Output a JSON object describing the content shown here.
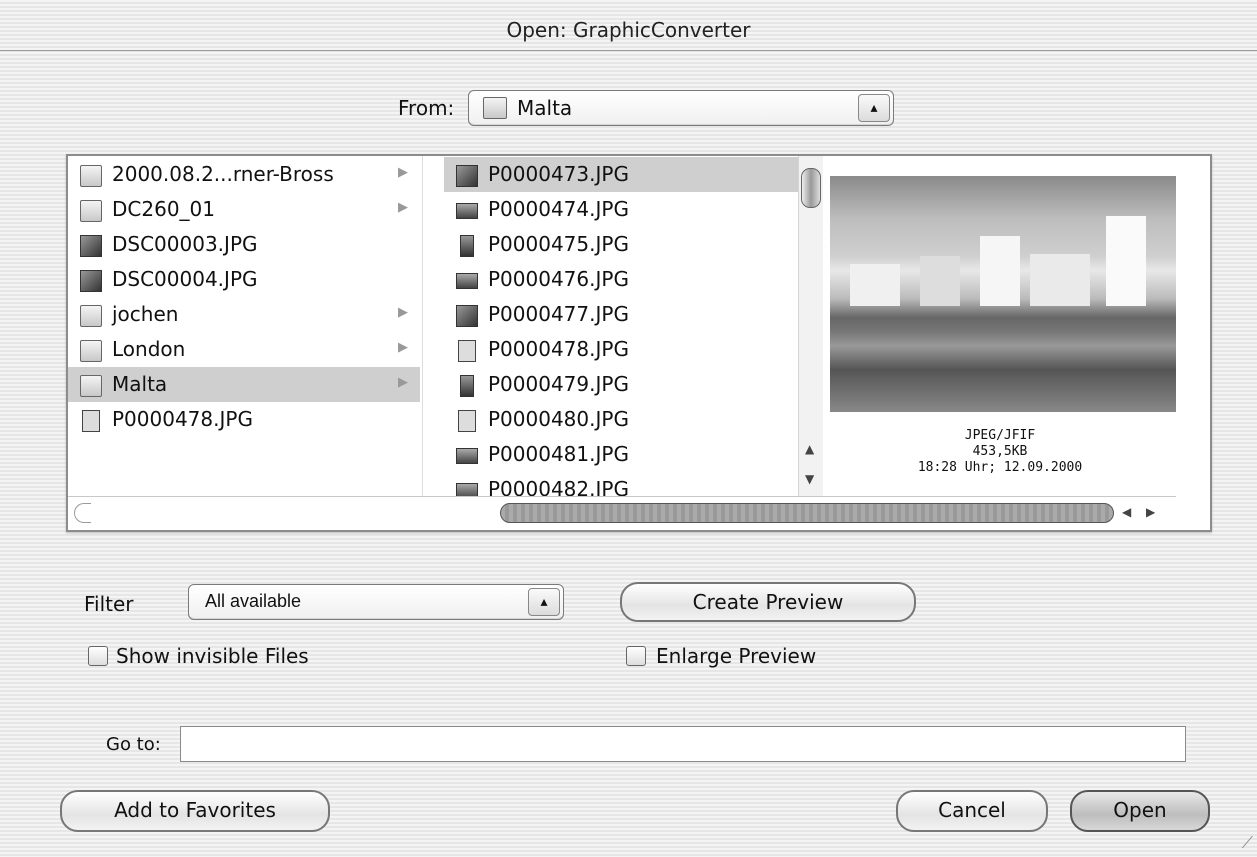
{
  "window": {
    "title": "Open: GraphicConverter"
  },
  "from": {
    "label": "From:",
    "value": "Malta",
    "icon": "folder-icon"
  },
  "columns": {
    "left": [
      {
        "name": "2000.08.2...rner-Bross",
        "icon": "folder-icon",
        "has_children": true,
        "selected": false
      },
      {
        "name": "DC260_01",
        "icon": "folder-icon",
        "has_children": true,
        "selected": false
      },
      {
        "name": "DSC00003.JPG",
        "icon": "photo-icon",
        "has_children": false,
        "selected": false
      },
      {
        "name": "DSC00004.JPG",
        "icon": "photo-icon",
        "has_children": false,
        "selected": false
      },
      {
        "name": "jochen",
        "icon": "folder-icon",
        "has_children": true,
        "selected": false
      },
      {
        "name": "London",
        "icon": "folder-icon",
        "has_children": true,
        "selected": false
      },
      {
        "name": "Malta",
        "icon": "folder-icon",
        "has_children": true,
        "selected": true
      },
      {
        "name": "P0000478.JPG",
        "icon": "file-icon",
        "has_children": false,
        "selected": false
      }
    ],
    "right": [
      {
        "name": "P0000473.JPG",
        "icon": "photo-icon",
        "selected": true
      },
      {
        "name": "P0000474.JPG",
        "icon": "photo-icon",
        "selected": false
      },
      {
        "name": "P0000475.JPG",
        "icon": "photo-icon",
        "selected": false
      },
      {
        "name": "P0000476.JPG",
        "icon": "photo-icon",
        "selected": false
      },
      {
        "name": "P0000477.JPG",
        "icon": "photo-icon",
        "selected": false
      },
      {
        "name": "P0000478.JPG",
        "icon": "photo-icon",
        "selected": false
      },
      {
        "name": "P0000479.JPG",
        "icon": "photo-icon",
        "selected": false
      },
      {
        "name": "P0000480.JPG",
        "icon": "photo-icon",
        "selected": false
      },
      {
        "name": "P0000481.JPG",
        "icon": "photo-icon",
        "selected": false
      },
      {
        "name": "P0000482.JPG",
        "icon": "photo-icon",
        "selected": false
      }
    ]
  },
  "preview": {
    "format": "JPEG/JFIF",
    "size": "453,5KB",
    "date": "18:28 Uhr; 12.09.2000"
  },
  "filter": {
    "label": "Filter",
    "value": "All available"
  },
  "buttons": {
    "create_preview": "Create Preview",
    "add_to_favorites": "Add to Favorites",
    "cancel": "Cancel",
    "open": "Open"
  },
  "checkboxes": {
    "show_invisible": {
      "label": "Show invisible Files",
      "checked": false
    },
    "enlarge_preview": {
      "label": "Enlarge Preview",
      "checked": false
    }
  },
  "goto": {
    "label": "Go to:",
    "value": ""
  }
}
